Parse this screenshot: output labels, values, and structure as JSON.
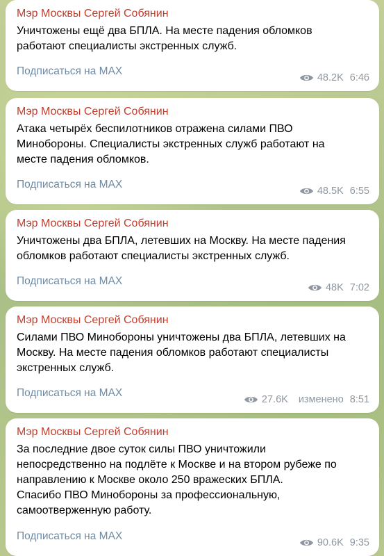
{
  "channel": {
    "colors": {
      "sender": "#c33d2c",
      "link": "#6f8ba4",
      "meta": "#8e979f",
      "bubble": "#ffffff"
    }
  },
  "messages": [
    {
      "sender": "Мэр Москвы Сергей Собянин",
      "text": "Уничтожены ещё два БПЛА. На месте падения обломков\nработают специалисты экстренных служб.",
      "subscribe": "Подписаться на MAX",
      "views": "48.2K",
      "edited": "",
      "time": "6:46"
    },
    {
      "sender": "Мэр Москвы Сергей Собянин",
      "text": "Атака четырёх беспилотников отражена силами ПВО\nМинобороны. Специалисты экстренных служб работают на\nместе падения обломков.",
      "subscribe": "Подписаться на MAX",
      "views": "48.5K",
      "edited": "",
      "time": "6:55"
    },
    {
      "sender": "Мэр Москвы Сергей Собянин",
      "text": "Уничтожены два БПЛА, летевших на Москву. На месте падения\nобломков работают специалисты экстренных служб.",
      "subscribe": "Подписаться на MAX",
      "views": "48K",
      "edited": "",
      "time": "7:02"
    },
    {
      "sender": "Мэр Москвы Сергей Собянин",
      "text": "Силами ПВО Минобороны уничтожены два БПЛА, летевших на\nМоскву. На месте падения обломков работают специалисты\nэкстренных служб.",
      "subscribe": "Подписаться на MAX",
      "views": "27.6K",
      "edited": "изменено",
      "time": "8:51"
    },
    {
      "sender": "Мэр Москвы Сергей Собянин",
      "text": "За последние двое суток силы ПВО уничтожили\nнепосредственно на подлёте к Москве и на втором рубеже по\nнаправлению к Москве около 250 вражеских БПЛА.\nСпасибо ПВО Минобороны за профессиональную,\nсамоотверженную работу.",
      "subscribe": "Подписаться на MAX",
      "views": "90.6K",
      "edited": "",
      "time": "9:35"
    }
  ]
}
